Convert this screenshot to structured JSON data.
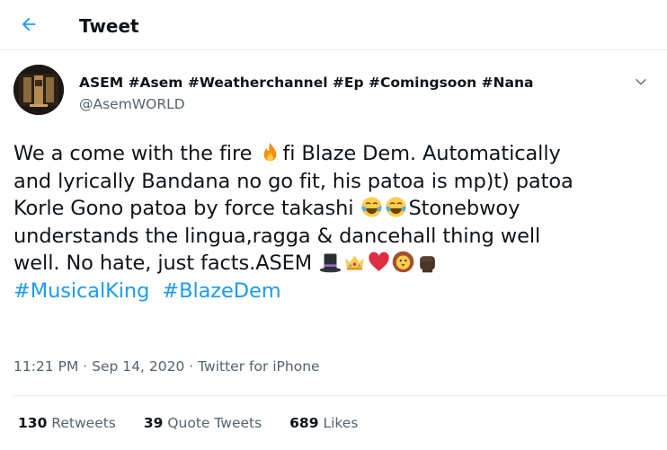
{
  "header": {
    "title": "Tweet"
  },
  "tweet": {
    "display_name": "ASEM #Asem #Weatherchannel #Ep #Comingsoon #Nana",
    "handle": "@AsemWORLD",
    "lines": {
      "l1a": "We a come with the fire ",
      "l1b": "fi Blaze Dem. Automatically",
      "l2": "and lyrically  Bandana no go fit, his patoa is mp)t) patoa",
      "l3a": "Korle Gono patoa by force takashi ",
      "l3b": "Stonebwoy",
      "l4": "understands the lingua,ragga & dancehall thing well",
      "l5a": "well. No hate, just facts.ASEM ",
      "hashtag1": "#MusicalKing",
      "hashtag2": "#BlazeDem"
    },
    "time": "11:21 PM",
    "date": "Sep 14, 2020",
    "sep": "·",
    "source": "Twitter for iPhone"
  },
  "stats": {
    "retweets_count": "130",
    "retweets_label": "Retweets",
    "quotes_count": "39",
    "quotes_label": "Quote Tweets",
    "likes_count": "689",
    "likes_label": "Likes"
  },
  "colors": {
    "accent": "#1d9bf0",
    "text": "#0f1419",
    "secondary": "#536471",
    "divider": "#e6ecf0"
  },
  "icons": {
    "back": "arrow-left-icon",
    "more": "chevron-down-icon",
    "emojis": [
      "fire",
      "tears-of-joy",
      "tears-of-joy",
      "top-hat",
      "crown",
      "red-heart",
      "lion",
      "raised-fist-dark"
    ]
  }
}
